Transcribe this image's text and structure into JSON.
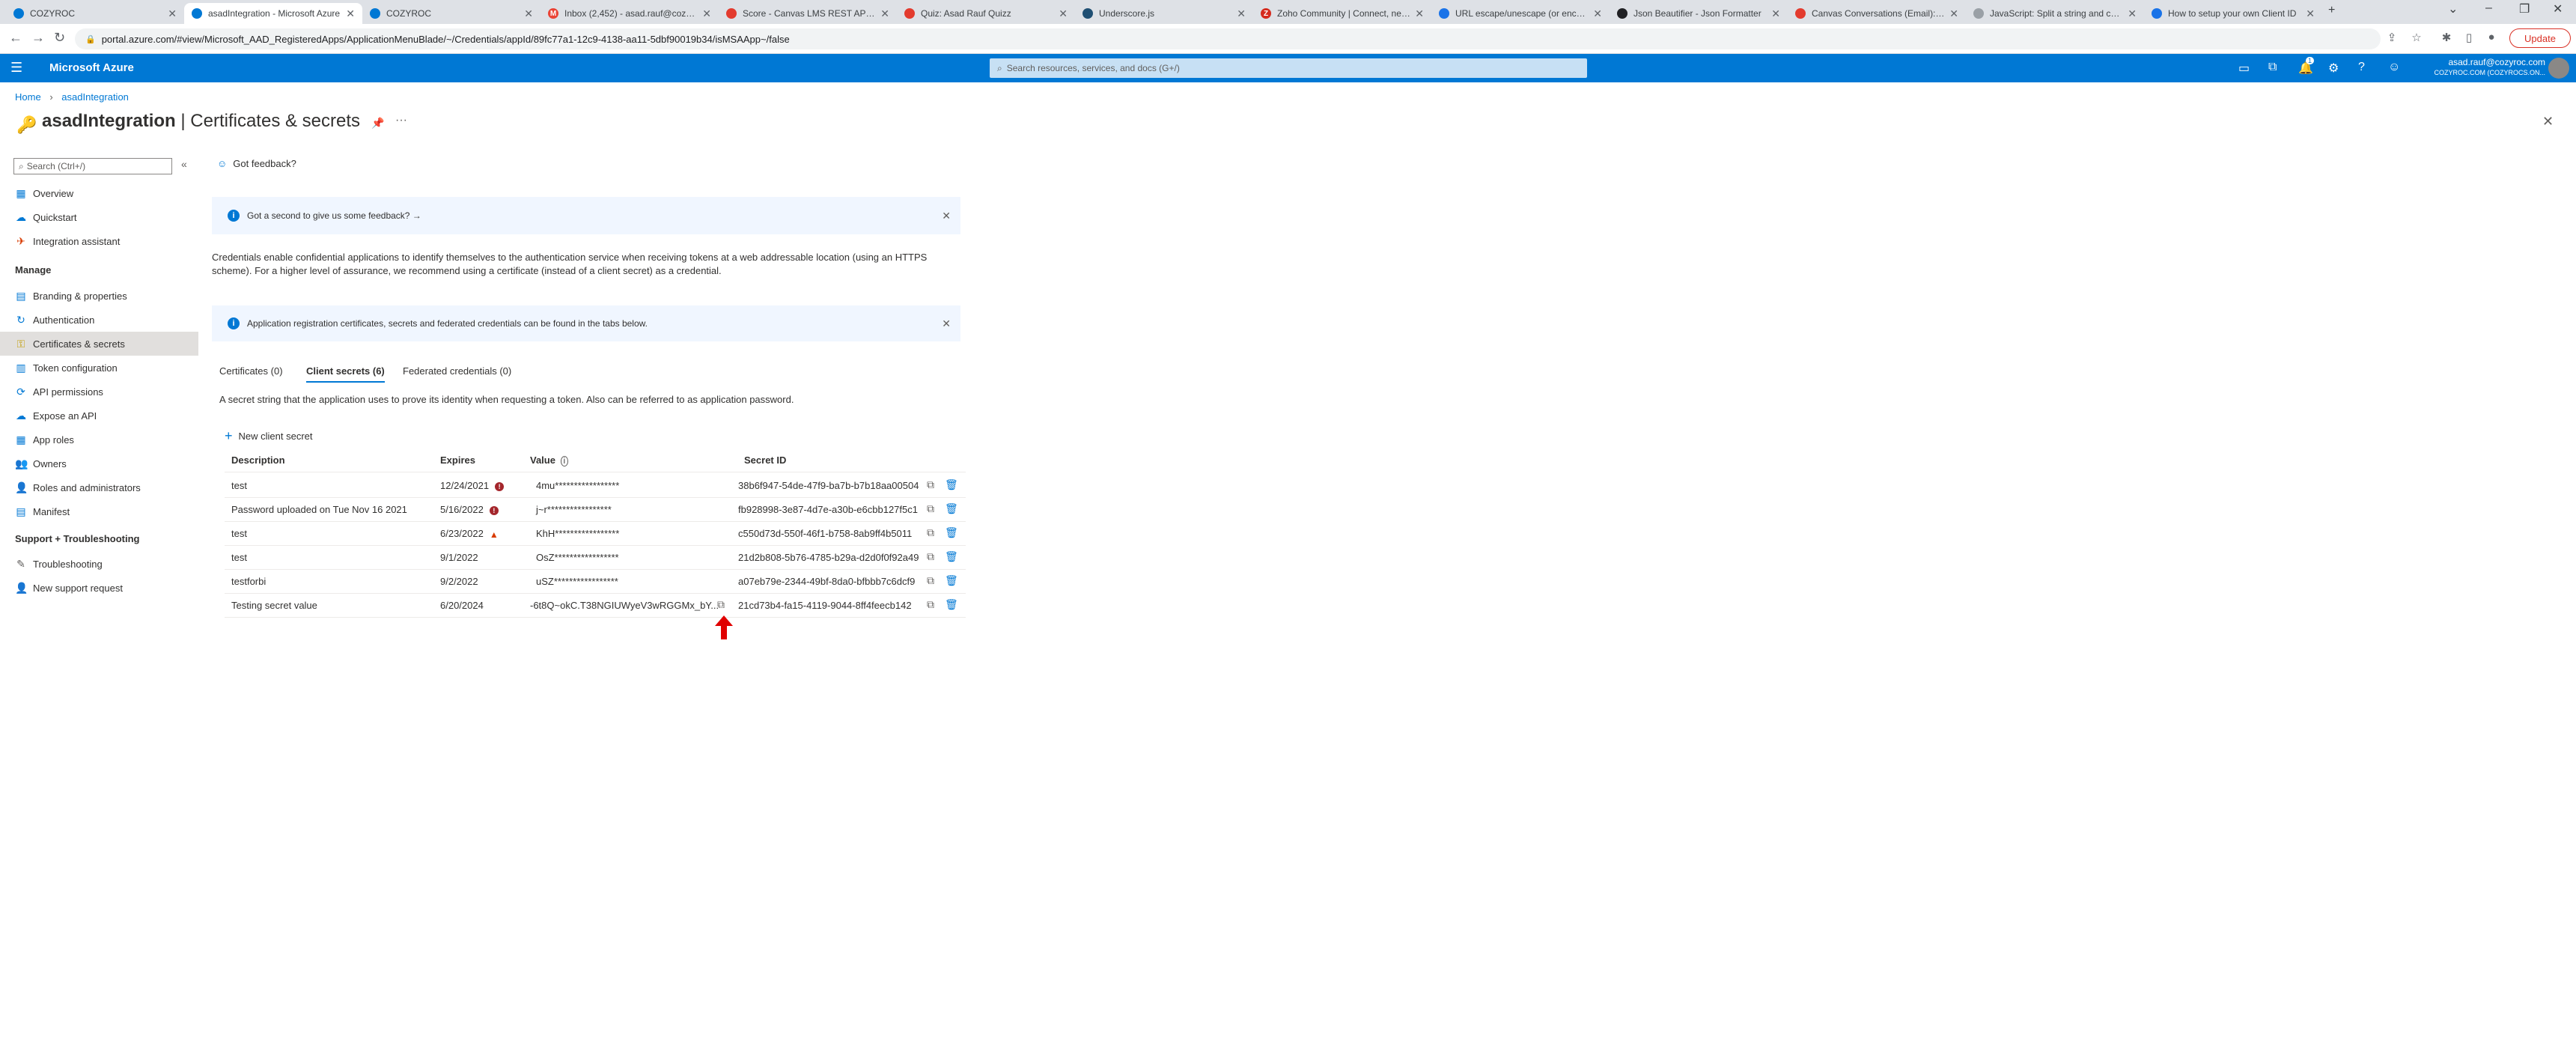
{
  "browser": {
    "tabs": [
      {
        "title": "COZYROC",
        "fav_color": "#0078d4",
        "fav_letter": "",
        "active": false
      },
      {
        "title": "asadIntegration - Microsoft Azure",
        "fav_color": "#0078d4",
        "fav_letter": "",
        "active": true
      },
      {
        "title": "COZYROC",
        "fav_color": "#0078d4",
        "fav_letter": "",
        "active": false
      },
      {
        "title": "Inbox (2,452) - asad.rauf@cozyroc",
        "fav_color": "#ea4335",
        "fav_letter": "M",
        "active": false
      },
      {
        "title": "Score - Canvas LMS REST API Do",
        "fav_color": "#e33b2e",
        "fav_letter": "",
        "active": false
      },
      {
        "title": "Quiz: Asad Rauf Quizz",
        "fav_color": "#e33b2e",
        "fav_letter": "",
        "active": false
      },
      {
        "title": "Underscore.js",
        "fav_color": "#1f4f73",
        "fav_letter": "",
        "active": false
      },
      {
        "title": "Zoho Community | Connect, network",
        "fav_color": "#d52b1e",
        "fav_letter": "Z",
        "active": false
      },
      {
        "title": "URL escape/unescape (or encode",
        "fav_color": "#1a73e8",
        "fav_letter": "",
        "active": false
      },
      {
        "title": "Json Beautifier - Json Formatter",
        "fav_color": "#202124",
        "fav_letter": "",
        "active": false
      },
      {
        "title": "Canvas Conversations (Email): Can",
        "fav_color": "#e33b2e",
        "fav_letter": "",
        "active": false
      },
      {
        "title": "JavaScript: Split a string and conv",
        "fav_color": "#9aa0a6",
        "fav_letter": "",
        "active": false
      },
      {
        "title": "How to setup your own Client ID",
        "fav_color": "#1a73e8",
        "fav_letter": "",
        "active": false
      }
    ],
    "url": "portal.azure.com/#view/Microsoft_AAD_RegisteredApps/ApplicationMenuBlade/~/Credentials/appId/89fc77a1-12c9-4138-aa11-5dbf90019b34/isMSAApp~/false",
    "update_label": "Update"
  },
  "azure": {
    "brand": "Microsoft Azure",
    "search_placeholder": "Search resources, services, and docs (G+/)",
    "account_email": "asad.rauf@cozyroc.com",
    "account_org": "COZYROC.COM (COZYROCS.ON...",
    "notification_count": "1"
  },
  "breadcrumb": {
    "home": "Home",
    "resource": "asadIntegration"
  },
  "page": {
    "resource_name": "asadIntegration",
    "separator": " | ",
    "blade_title": "Certificates & secrets",
    "feedback_label": "Got feedback?"
  },
  "sidebar": {
    "search_placeholder": "Search (Ctrl+/)",
    "top_items": [
      {
        "label": "Overview",
        "icon": "grid-icon",
        "glyph": "▦",
        "color": "#0078d4"
      },
      {
        "label": "Quickstart",
        "icon": "cloud-icon",
        "glyph": "☁",
        "color": "#0078d4"
      },
      {
        "label": "Integration assistant",
        "icon": "rocket-icon",
        "glyph": "✈",
        "color": "#d83b01"
      }
    ],
    "manage_header": "Manage",
    "manage_items": [
      {
        "label": "Branding & properties",
        "icon": "branding-icon",
        "glyph": "▤",
        "color": "#0078d4",
        "selected": false
      },
      {
        "label": "Authentication",
        "icon": "authentication-icon",
        "glyph": "↻",
        "color": "#0078d4",
        "selected": false
      },
      {
        "label": "Certificates & secrets",
        "icon": "key-icon",
        "glyph": "⚿",
        "color": "#c19c00",
        "selected": true
      },
      {
        "label": "Token configuration",
        "icon": "token-icon",
        "glyph": "▥",
        "color": "#0078d4",
        "selected": false
      },
      {
        "label": "API permissions",
        "icon": "permissions-icon",
        "glyph": "⟳",
        "color": "#0078d4",
        "selected": false
      },
      {
        "label": "Expose an API",
        "icon": "cloud-api-icon",
        "glyph": "☁",
        "color": "#0078d4",
        "selected": false
      },
      {
        "label": "App roles",
        "icon": "app-roles-icon",
        "glyph": "▦",
        "color": "#0078d4",
        "selected": false
      },
      {
        "label": "Owners",
        "icon": "owners-icon",
        "glyph": "👥",
        "color": "#0078d4",
        "selected": false
      },
      {
        "label": "Roles and administrators",
        "icon": "roles-icon",
        "glyph": "👤",
        "color": "#107c10",
        "selected": false
      },
      {
        "label": "Manifest",
        "icon": "manifest-icon",
        "glyph": "▤",
        "color": "#0078d4",
        "selected": false
      }
    ],
    "support_header": "Support + Troubleshooting",
    "support_items": [
      {
        "label": "Troubleshooting",
        "icon": "wrench-icon",
        "glyph": "✎",
        "color": "#605e5c"
      },
      {
        "label": "New support request",
        "icon": "support-icon",
        "glyph": "👤",
        "color": "#0078d4"
      }
    ]
  },
  "banners": {
    "feedback": "Got a second to give us some feedback? →",
    "tabs_info": "Application registration certificates, secrets and federated credentials can be found in the tabs below."
  },
  "description": "Credentials enable confidential applications to identify themselves to the authentication service when receiving tokens at a web addressable location (using an HTTPS scheme). For a higher level of assurance, we recommend using a certificate (instead of a client secret) as a credential.",
  "cred_tabs": [
    {
      "label": "Certificates (0)",
      "selected": false
    },
    {
      "label": "Client secrets (6)",
      "selected": true
    },
    {
      "label": "Federated credentials (0)",
      "selected": false
    }
  ],
  "secrets_description": "A secret string that the application uses to prove its identity when requesting a token. Also can be referred to as application password.",
  "new_secret_label": "New client secret",
  "table": {
    "headers": {
      "description": "Description",
      "expires": "Expires",
      "value": "Value",
      "secret_id": "Secret ID"
    },
    "rows": [
      {
        "description": "test",
        "expires": "12/24/2021",
        "status": "error",
        "value": "4mu*****************",
        "secret_id": "38b6f947-54de-47f9-ba7b-b7b18aa00504"
      },
      {
        "description": "Password uploaded on Tue Nov 16 2021",
        "expires": "5/16/2022",
        "status": "error",
        "value": "j~r*****************",
        "secret_id": "fb928998-3e87-4d7e-a30b-e6cbb127f5c1"
      },
      {
        "description": "test",
        "expires": "6/23/2022",
        "status": "warning",
        "value": "KhH*****************",
        "secret_id": "c550d73d-550f-46f1-b758-8ab9ff4b5011"
      },
      {
        "description": "test",
        "expires": "9/1/2022",
        "status": "",
        "value": "OsZ*****************",
        "secret_id": "21d2b808-5b76-4785-b29a-d2d0f0f92a49"
      },
      {
        "description": "testforbi",
        "expires": "9/2/2022",
        "status": "",
        "value": "uSZ*****************",
        "secret_id": "a07eb79e-2344-49bf-8da0-bfbbb7c6dcf9"
      },
      {
        "description": "Testing secret value",
        "expires": "6/20/2024",
        "status": "",
        "value": "-6t8Q~okC.T38NGIUWyeV3wRGGMx_bY...",
        "secret_id": "21cd73b4-fa15-4119-9044-8ff4feecb142",
        "value_copy": true
      }
    ]
  },
  "colors": {
    "azure_blue": "#0078d4",
    "error": "#a4262c",
    "warning": "#d83b01",
    "annotation_arrow": "#e00000"
  }
}
